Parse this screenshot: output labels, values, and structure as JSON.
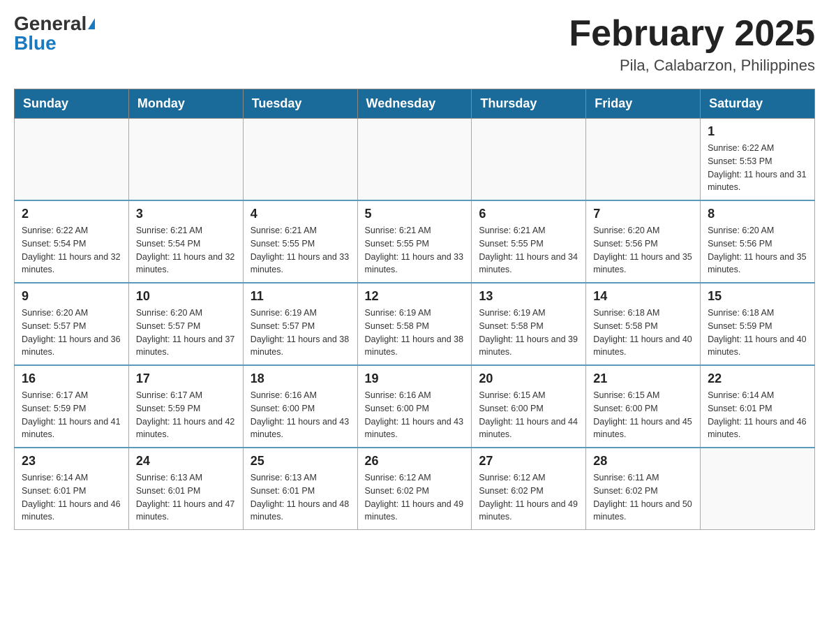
{
  "header": {
    "logo_general": "General",
    "logo_blue": "Blue",
    "title": "February 2025",
    "subtitle": "Pila, Calabarzon, Philippines"
  },
  "weekdays": [
    "Sunday",
    "Monday",
    "Tuesday",
    "Wednesday",
    "Thursday",
    "Friday",
    "Saturday"
  ],
  "weeks": [
    [
      {
        "day": "",
        "info": ""
      },
      {
        "day": "",
        "info": ""
      },
      {
        "day": "",
        "info": ""
      },
      {
        "day": "",
        "info": ""
      },
      {
        "day": "",
        "info": ""
      },
      {
        "day": "",
        "info": ""
      },
      {
        "day": "1",
        "info": "Sunrise: 6:22 AM\nSunset: 5:53 PM\nDaylight: 11 hours and 31 minutes."
      }
    ],
    [
      {
        "day": "2",
        "info": "Sunrise: 6:22 AM\nSunset: 5:54 PM\nDaylight: 11 hours and 32 minutes."
      },
      {
        "day": "3",
        "info": "Sunrise: 6:21 AM\nSunset: 5:54 PM\nDaylight: 11 hours and 32 minutes."
      },
      {
        "day": "4",
        "info": "Sunrise: 6:21 AM\nSunset: 5:55 PM\nDaylight: 11 hours and 33 minutes."
      },
      {
        "day": "5",
        "info": "Sunrise: 6:21 AM\nSunset: 5:55 PM\nDaylight: 11 hours and 33 minutes."
      },
      {
        "day": "6",
        "info": "Sunrise: 6:21 AM\nSunset: 5:55 PM\nDaylight: 11 hours and 34 minutes."
      },
      {
        "day": "7",
        "info": "Sunrise: 6:20 AM\nSunset: 5:56 PM\nDaylight: 11 hours and 35 minutes."
      },
      {
        "day": "8",
        "info": "Sunrise: 6:20 AM\nSunset: 5:56 PM\nDaylight: 11 hours and 35 minutes."
      }
    ],
    [
      {
        "day": "9",
        "info": "Sunrise: 6:20 AM\nSunset: 5:57 PM\nDaylight: 11 hours and 36 minutes."
      },
      {
        "day": "10",
        "info": "Sunrise: 6:20 AM\nSunset: 5:57 PM\nDaylight: 11 hours and 37 minutes."
      },
      {
        "day": "11",
        "info": "Sunrise: 6:19 AM\nSunset: 5:57 PM\nDaylight: 11 hours and 38 minutes."
      },
      {
        "day": "12",
        "info": "Sunrise: 6:19 AM\nSunset: 5:58 PM\nDaylight: 11 hours and 38 minutes."
      },
      {
        "day": "13",
        "info": "Sunrise: 6:19 AM\nSunset: 5:58 PM\nDaylight: 11 hours and 39 minutes."
      },
      {
        "day": "14",
        "info": "Sunrise: 6:18 AM\nSunset: 5:58 PM\nDaylight: 11 hours and 40 minutes."
      },
      {
        "day": "15",
        "info": "Sunrise: 6:18 AM\nSunset: 5:59 PM\nDaylight: 11 hours and 40 minutes."
      }
    ],
    [
      {
        "day": "16",
        "info": "Sunrise: 6:17 AM\nSunset: 5:59 PM\nDaylight: 11 hours and 41 minutes."
      },
      {
        "day": "17",
        "info": "Sunrise: 6:17 AM\nSunset: 5:59 PM\nDaylight: 11 hours and 42 minutes."
      },
      {
        "day": "18",
        "info": "Sunrise: 6:16 AM\nSunset: 6:00 PM\nDaylight: 11 hours and 43 minutes."
      },
      {
        "day": "19",
        "info": "Sunrise: 6:16 AM\nSunset: 6:00 PM\nDaylight: 11 hours and 43 minutes."
      },
      {
        "day": "20",
        "info": "Sunrise: 6:15 AM\nSunset: 6:00 PM\nDaylight: 11 hours and 44 minutes."
      },
      {
        "day": "21",
        "info": "Sunrise: 6:15 AM\nSunset: 6:00 PM\nDaylight: 11 hours and 45 minutes."
      },
      {
        "day": "22",
        "info": "Sunrise: 6:14 AM\nSunset: 6:01 PM\nDaylight: 11 hours and 46 minutes."
      }
    ],
    [
      {
        "day": "23",
        "info": "Sunrise: 6:14 AM\nSunset: 6:01 PM\nDaylight: 11 hours and 46 minutes."
      },
      {
        "day": "24",
        "info": "Sunrise: 6:13 AM\nSunset: 6:01 PM\nDaylight: 11 hours and 47 minutes."
      },
      {
        "day": "25",
        "info": "Sunrise: 6:13 AM\nSunset: 6:01 PM\nDaylight: 11 hours and 48 minutes."
      },
      {
        "day": "26",
        "info": "Sunrise: 6:12 AM\nSunset: 6:02 PM\nDaylight: 11 hours and 49 minutes."
      },
      {
        "day": "27",
        "info": "Sunrise: 6:12 AM\nSunset: 6:02 PM\nDaylight: 11 hours and 49 minutes."
      },
      {
        "day": "28",
        "info": "Sunrise: 6:11 AM\nSunset: 6:02 PM\nDaylight: 11 hours and 50 minutes."
      },
      {
        "day": "",
        "info": ""
      }
    ]
  ]
}
